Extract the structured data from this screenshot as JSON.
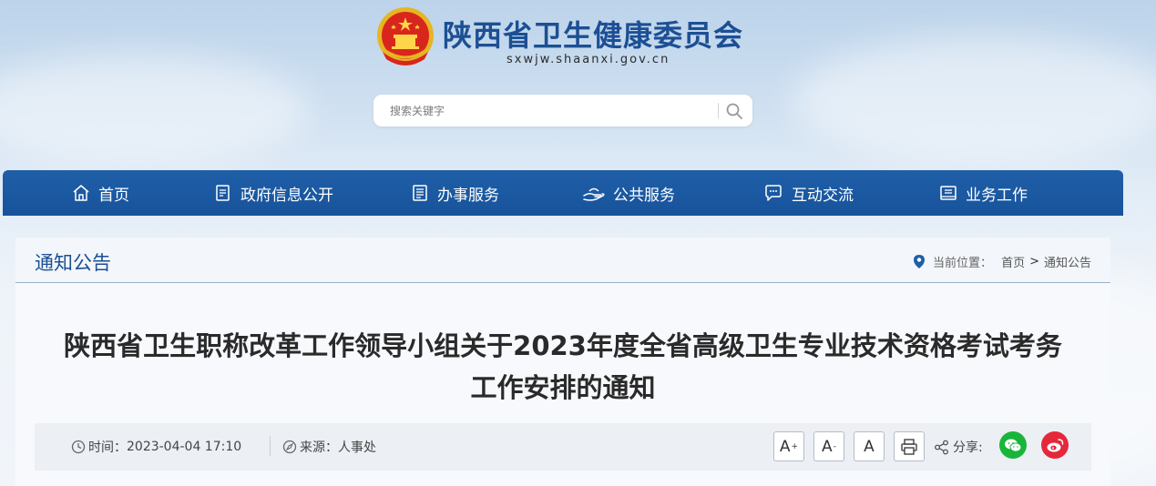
{
  "header": {
    "site_title": "陕西省卫生健康委员会",
    "site_domain": "sxwjw.shaanxi.gov.cn",
    "emblem_icon": "national-emblem-icon"
  },
  "search": {
    "placeholder": "搜索关键字",
    "icon": "search-icon"
  },
  "nav": {
    "items": [
      {
        "label": "首页",
        "icon": "home-icon"
      },
      {
        "label": "政府信息公开",
        "icon": "document-icon"
      },
      {
        "label": "办事服务",
        "icon": "form-icon"
      },
      {
        "label": "公共服务",
        "icon": "hands-icon"
      },
      {
        "label": "互动交流",
        "icon": "chat-icon"
      },
      {
        "label": "业务工作",
        "icon": "briefcase-icon"
      }
    ]
  },
  "section": {
    "title": "通知公告",
    "breadcrumb": {
      "prefix": "当前位置：",
      "home": "首页",
      "separator": ">",
      "current": "通知公告"
    }
  },
  "article": {
    "title": "陕西省卫生职称改革工作领导小组关于2023年度全省高级卫生专业技术资格考试考务工作安排的通知",
    "time_label": "时间：",
    "time_value": "2023-04-04 17:10",
    "source_label": "来源：",
    "source_value": "人事处",
    "font_large": "A",
    "font_large_sup": "+",
    "font_small": "A",
    "font_small_sup": "-",
    "font_default": "A",
    "share_label": "分享:"
  },
  "colors": {
    "nav_bg": "#1f5fa8",
    "title_blue": "#1c4f94",
    "wechat_green": "#19b53b",
    "weibo_red": "#e5273a"
  }
}
